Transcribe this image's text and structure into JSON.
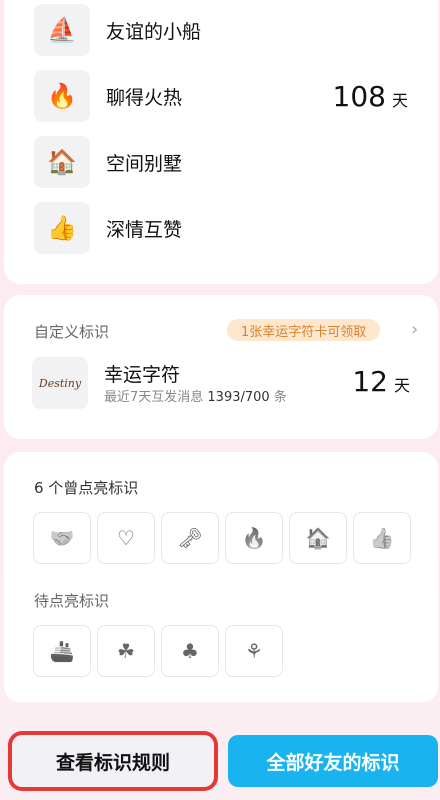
{
  "marks": [
    {
      "icon": "⛵",
      "icon_name": "boat-icon",
      "label": "友谊的小船",
      "days": "",
      "unit": ""
    },
    {
      "icon": "🔥",
      "icon_name": "fire-icon",
      "label": "聊得火热",
      "days": "108",
      "unit": "天"
    },
    {
      "icon": "🏠",
      "icon_name": "villa-icon",
      "label": "空间别墅",
      "days": "",
      "unit": ""
    },
    {
      "icon": "👍",
      "icon_name": "thumbs-up-icon",
      "label": "深情互赞",
      "days": "",
      "unit": ""
    }
  ],
  "custom": {
    "section_label": "自定义标识",
    "badge": "1张幸运字符卡可领取",
    "lucky_icon_text": "Destiny",
    "lucky_title": "幸运字符",
    "lucky_sub_prefix": "最近7天互发消息 ",
    "lucky_sub_value": "1393/700",
    "lucky_sub_suffix": " 条",
    "lucky_days": "12",
    "lucky_unit": "天"
  },
  "lit": {
    "count_label": "6 个曾点亮标识",
    "lit_icons": [
      {
        "icon": "🤝",
        "name": "heart-hands-icon"
      },
      {
        "icon": "♡",
        "name": "heart-icon"
      },
      {
        "icon": "🗝",
        "name": "key-icon"
      },
      {
        "icon": "🔥",
        "name": "flame-icon"
      },
      {
        "icon": "🏠",
        "name": "house-icon"
      },
      {
        "icon": "👍",
        "name": "thumbs-up-icon"
      }
    ],
    "pending_label": "待点亮标识",
    "pending_icons": [
      {
        "icon": "🚢",
        "name": "ship-icon"
      },
      {
        "icon": "☘",
        "name": "clover-icon"
      },
      {
        "icon": "♣",
        "name": "clover-small-icon"
      },
      {
        "icon": "⚘",
        "name": "sprout-icon"
      }
    ]
  },
  "buttons": {
    "rules": "查看标识规则",
    "all_friends": "全部好友的标识"
  },
  "colors": {
    "accent_blue": "#19b4f0",
    "badge_bg": "#fde7cf",
    "badge_text": "#d9822b",
    "highlight_border": "#e53935"
  }
}
